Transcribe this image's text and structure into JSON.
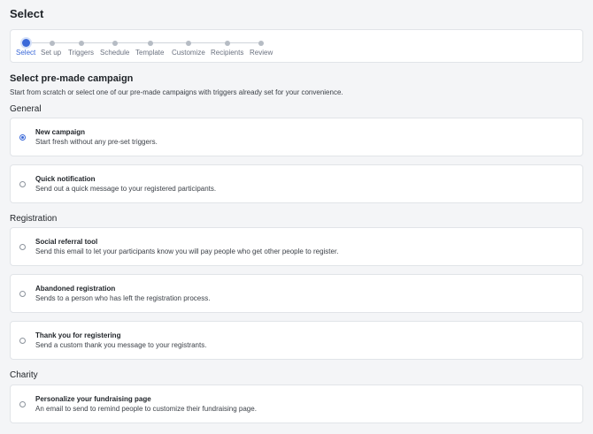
{
  "page": {
    "title": "Select"
  },
  "stepper": {
    "steps": [
      {
        "label": "Select",
        "active": true
      },
      {
        "label": "Set up",
        "active": false
      },
      {
        "label": "Triggers",
        "active": false
      },
      {
        "label": "Schedule",
        "active": false
      },
      {
        "label": "Template",
        "active": false
      },
      {
        "label": "Customize",
        "active": false
      },
      {
        "label": "Recipients",
        "active": false
      },
      {
        "label": "Review",
        "active": false
      }
    ]
  },
  "main": {
    "heading": "Select pre-made campaign",
    "subtitle": "Start from scratch or select one of our pre-made campaigns with triggers already set for your convenience."
  },
  "groups": [
    {
      "title": "General",
      "options": [
        {
          "title": "New campaign",
          "desc": "Start fresh without any pre-set triggers.",
          "checked": true
        },
        {
          "title": "Quick notification",
          "desc": "Send out a quick message to your registered participants.",
          "checked": false
        }
      ]
    },
    {
      "title": "Registration",
      "options": [
        {
          "title": "Social referral tool",
          "desc": "Send this email to let your participants know you will pay people who get other people to register.",
          "checked": false
        },
        {
          "title": "Abandoned registration",
          "desc": "Sends to a person who has left the registration process.",
          "checked": false
        },
        {
          "title": "Thank you for registering",
          "desc": "Send a custom thank you message to your registrants.",
          "checked": false
        }
      ]
    },
    {
      "title": "Charity",
      "options": [
        {
          "title": "Personalize your fundraising page",
          "desc": "An email to send to remind people to customize their fundraising page.",
          "checked": false
        }
      ]
    }
  ],
  "colors": {
    "accent": "#3a68d8",
    "background": "#f4f5f7",
    "card": "#ffffff",
    "border": "#e1e4e8"
  }
}
